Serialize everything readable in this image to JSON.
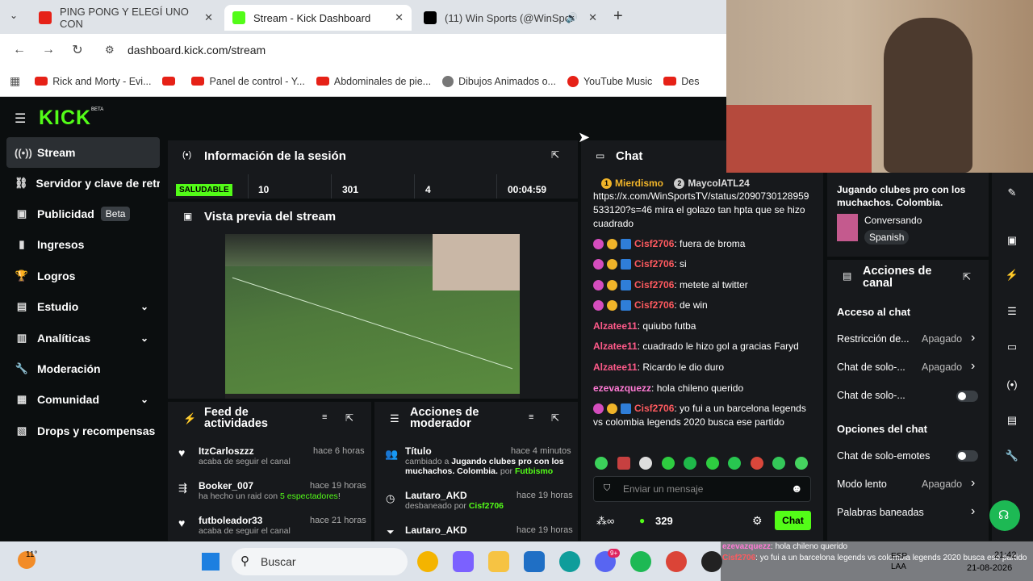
{
  "browser": {
    "tabs": [
      {
        "title": "PING PONG Y ELEGÍ UNO CON",
        "favicon_color": "#e62117"
      },
      {
        "title": "Stream - Kick Dashboard",
        "favicon_color": "#53fc18"
      },
      {
        "title": "(11) Win Sports (@WinSpor",
        "favicon_color": "#000000"
      }
    ],
    "new_tab": "+",
    "url": "dashboard.kick.com/stream",
    "bookmarks": [
      "Rick and Morty - Evi...",
      "",
      "Panel de control - Y...",
      "Abdominales de pie...",
      "Dibujos Animados o...",
      "YouTube Music",
      "Des"
    ]
  },
  "kick": {
    "logo": "KICK",
    "logo_beta": "BETA",
    "sidebar": [
      {
        "label": "Stream",
        "icon": "broadcast-icon"
      },
      {
        "label": "Servidor y clave de retransmisión",
        "icon": "link-icon"
      },
      {
        "label": "Publicidad",
        "icon": "ad-icon",
        "badge": "Beta"
      },
      {
        "label": "Ingresos",
        "icon": "revenue-icon"
      },
      {
        "label": "Logros",
        "icon": "trophy-icon"
      },
      {
        "label": "Estudio",
        "icon": "studio-icon",
        "expand": "⌄"
      },
      {
        "label": "Analíticas",
        "icon": "analytics-icon",
        "expand": "⌄"
      },
      {
        "label": "Moderación",
        "icon": "wrench-icon"
      },
      {
        "label": "Comunidad",
        "icon": "community-icon",
        "expand": "⌄"
      },
      {
        "label": "Drops y recompensas",
        "icon": "drops-icon"
      }
    ],
    "session": {
      "title": "Información de la sesión",
      "health": "SALUDABLE",
      "stats": [
        "10",
        "301",
        "4",
        "00:04:59"
      ]
    },
    "preview": {
      "title": "Vista previa del stream"
    },
    "activity": {
      "title": "Feed de actividades",
      "items": [
        {
          "name": "ItzCarloszzz",
          "time": "hace 6 horas",
          "text": "acaba de seguir el canal"
        },
        {
          "name": "Booker_007",
          "time": "hace 19 horas",
          "text_pre": "ha hecho un raid con ",
          "highlight": "5 espectadores",
          "text_post": "!"
        },
        {
          "name": "futboleador33",
          "time": "hace 21 horas",
          "text": "acaba de seguir el canal"
        }
      ]
    },
    "modactions": {
      "title": "Acciones de moderador",
      "items": [
        {
          "name": "Título",
          "time": "hace 4 minutos",
          "text_pre": "cambiado a ",
          "bold": "Jugando clubes pro con los muchachos. Colombia.",
          "text_mid": " por ",
          "by": "Futbismo"
        },
        {
          "name": "Lautaro_AKD",
          "time": "hace 19 horas",
          "text_pre": "desbaneado por ",
          "by": "Cisf2706"
        },
        {
          "name": "Lautaro_AKD",
          "time": "hace 19 horas"
        }
      ]
    },
    "chat": {
      "title": "Chat",
      "pinned": [
        {
          "rank": "1",
          "name": "Mierdismo"
        },
        {
          "rank": "2",
          "name": "MaycolATL24"
        }
      ],
      "link_msg": "https://x.com/WinSportsTV/status/2090730128959533120?s=46 mira el golazo tan hpta que se hizo cuadrado",
      "messages": [
        {
          "user": "Cisf2706",
          "color": "#ff5a5f",
          "text": "fuera de broma",
          "badges": true
        },
        {
          "user": "Cisf2706",
          "color": "#ff5a5f",
          "text": "si",
          "badges": true
        },
        {
          "user": "Cisf2706",
          "color": "#ff5a5f",
          "text": "metete al twitter",
          "badges": true
        },
        {
          "user": "Cisf2706",
          "color": "#ff5a5f",
          "text": "de win",
          "badges": true
        },
        {
          "user": "Alzatee11",
          "color": "#ff5a8a",
          "text": "quiubo futba",
          "badges": false
        },
        {
          "user": "Alzatee11",
          "color": "#ff5a8a",
          "text": "cuadrado le hizo gol a gracias Faryd",
          "badges": false
        },
        {
          "user": "Alzatee11",
          "color": "#ff5a8a",
          "text": "Ricardo le dio duro",
          "badges": false
        },
        {
          "user": "ezevazquezz",
          "color": "#ff7bd5",
          "text": "hola chileno querido",
          "badges": false
        },
        {
          "user": "Cisf2706",
          "color": "#ff5a5f",
          "text": "yo fui a un barcelona legends vs colombia legends 2020 busca ese partido",
          "badges": true
        }
      ],
      "input_placeholder": "Enviar un mensaje",
      "viewers": "329",
      "send_label": "Chat"
    },
    "stream_info": {
      "title": "Jugando clubes pro con los muchachos. Colombia.",
      "category": "Conversando",
      "language": "Spanish"
    },
    "channel_actions": {
      "title": "Acciones de canal",
      "chat_access": "Acceso al chat",
      "rows": [
        {
          "label": "Restricción de...",
          "value": "Apagado",
          "arrow": "›"
        },
        {
          "label": "Chat de solo-...",
          "value": "Apagado",
          "arrow": "›"
        },
        {
          "label": "Chat de solo-..."
        }
      ],
      "chat_options": "Opciones del chat",
      "rows2": [
        {
          "label": "Chat de solo-emotes"
        },
        {
          "label": "Modo lento",
          "value": "Apagado",
          "arrow": "›"
        },
        {
          "label": "Palabras baneadas",
          "arrow": "›"
        }
      ]
    }
  },
  "taskbar": {
    "weather": "11°",
    "search": "Buscar",
    "lang1": "ESP",
    "lang2": "LAA",
    "time": "21:42",
    "date": "21-08-2026",
    "notif": "9+",
    "overlay_line1_user": "ezevazquezz",
    "overlay_line1_text": ": hola chileno querido",
    "overlay_line2_user": "Cisf2706",
    "overlay_line2_text": ": yo fui a un barcelona legends vs colombia legends 2020 busca ese partido"
  },
  "colors": {
    "kick_green": "#53fc18",
    "panel": "#17191c",
    "bg": "#0b0e0f"
  }
}
